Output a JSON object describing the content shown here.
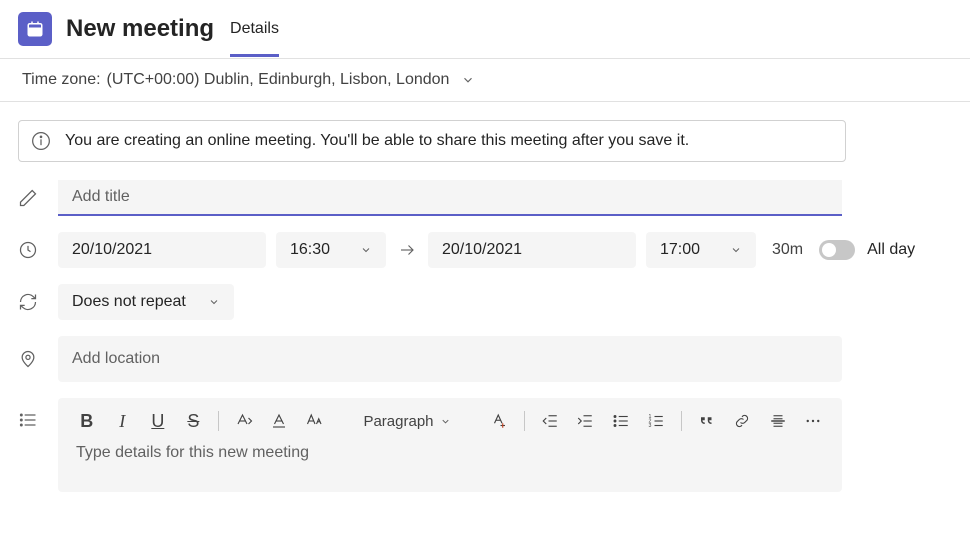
{
  "header": {
    "title": "New meeting",
    "tab": "Details"
  },
  "timezone": {
    "label": "Time zone:",
    "value": "(UTC+00:00) Dublin, Edinburgh, Lisbon, London"
  },
  "banner": "You are creating an online meeting. You'll be able to share this meeting after you save it.",
  "titleField": {
    "placeholder": "Add title",
    "value": ""
  },
  "dateTime": {
    "startDate": "20/10/2021",
    "startTime": "16:30",
    "endDate": "20/10/2021",
    "endTime": "17:00",
    "duration": "30m",
    "allDayLabel": "All day"
  },
  "recurrence": "Does not repeat",
  "location": {
    "placeholder": "Add location"
  },
  "editor": {
    "paragraphLabel": "Paragraph",
    "placeholder": "Type details for this new meeting"
  }
}
